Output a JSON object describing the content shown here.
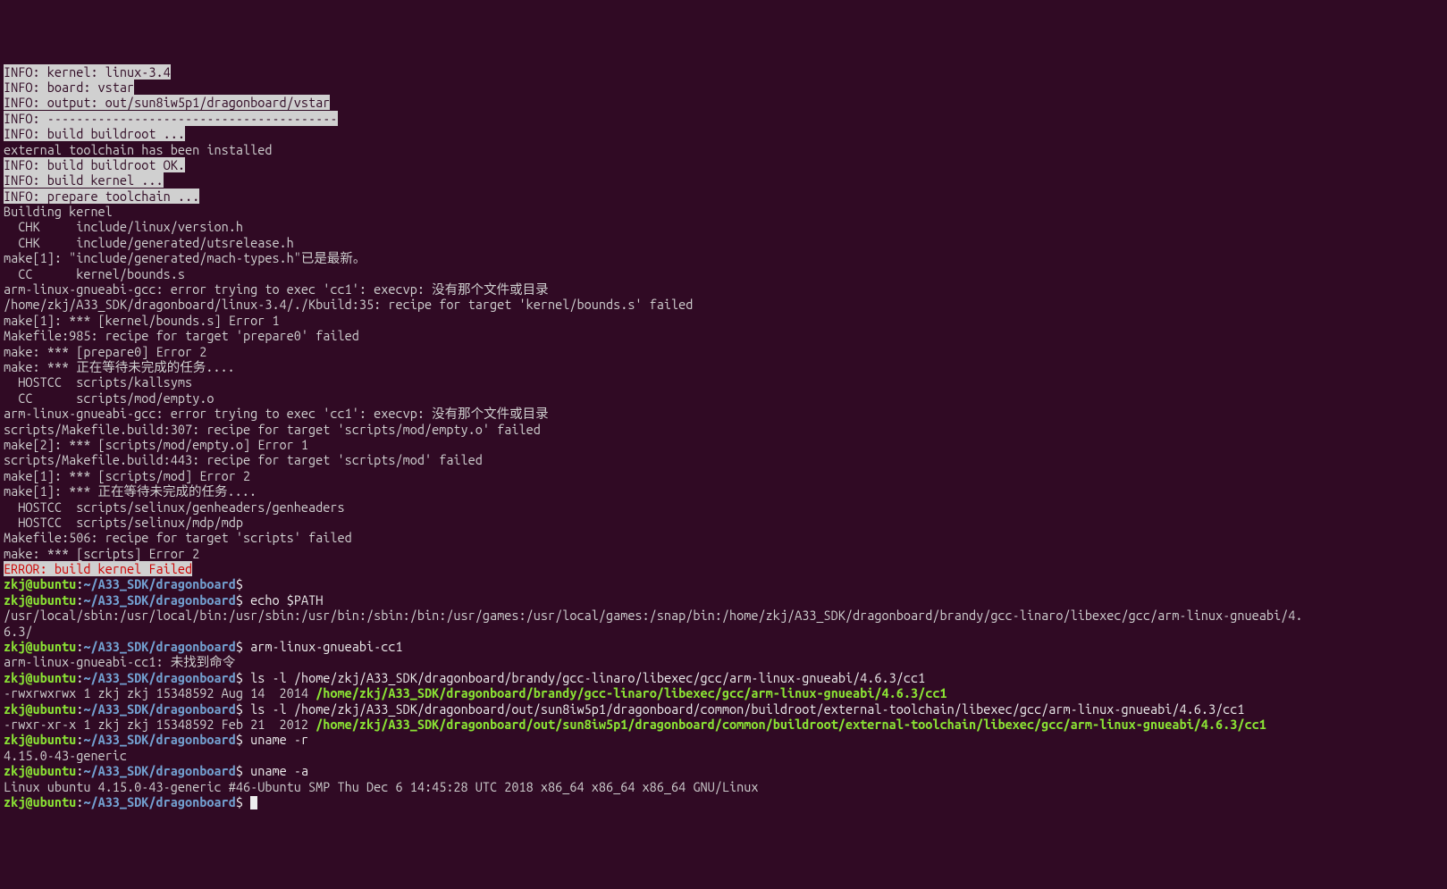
{
  "lines": [
    {
      "segs": [
        {
          "t": "INFO: kernel: linux-3.4",
          "cls": "hl"
        }
      ]
    },
    {
      "segs": [
        {
          "t": "INFO: board: vstar",
          "cls": "hl"
        }
      ]
    },
    {
      "segs": [
        {
          "t": "INFO: output: out/sun8iw5p1/dragonboard/vstar",
          "cls": "hl"
        }
      ]
    },
    {
      "segs": [
        {
          "t": "INFO: ----------------------------------------",
          "cls": "hl"
        }
      ]
    },
    {
      "segs": [
        {
          "t": "INFO: build buildroot ...",
          "cls": "hl"
        }
      ]
    },
    {
      "segs": [
        {
          "t": "external toolchain has been installed",
          "cls": ""
        }
      ]
    },
    {
      "segs": [
        {
          "t": "INFO: build buildroot OK.",
          "cls": "hl"
        }
      ]
    },
    {
      "segs": [
        {
          "t": "INFO: build kernel ...",
          "cls": "hl"
        }
      ]
    },
    {
      "segs": [
        {
          "t": "INFO: prepare toolchain ...",
          "cls": "hl"
        }
      ]
    },
    {
      "segs": [
        {
          "t": "Building kernel",
          "cls": ""
        }
      ]
    },
    {
      "segs": [
        {
          "t": "  CHK     include/linux/version.h",
          "cls": ""
        }
      ]
    },
    {
      "segs": [
        {
          "t": "  CHK     include/generated/utsrelease.h",
          "cls": ""
        }
      ]
    },
    {
      "segs": [
        {
          "t": "make[1]: \"include/generated/mach-types.h\"已是最新。",
          "cls": ""
        }
      ]
    },
    {
      "segs": [
        {
          "t": "  CC      kernel/bounds.s",
          "cls": ""
        }
      ]
    },
    {
      "segs": [
        {
          "t": "arm-linux-gnueabi-gcc: error trying to exec 'cc1': execvp: 没有那个文件或目录",
          "cls": ""
        }
      ]
    },
    {
      "segs": [
        {
          "t": "/home/zkj/A33_SDK/dragonboard/linux-3.4/./Kbuild:35: recipe for target 'kernel/bounds.s' failed",
          "cls": ""
        }
      ]
    },
    {
      "segs": [
        {
          "t": "make[1]: *** [kernel/bounds.s] Error 1",
          "cls": ""
        }
      ]
    },
    {
      "segs": [
        {
          "t": "Makefile:985: recipe for target 'prepare0' failed",
          "cls": ""
        }
      ]
    },
    {
      "segs": [
        {
          "t": "make: *** [prepare0] Error 2",
          "cls": ""
        }
      ]
    },
    {
      "segs": [
        {
          "t": "make: *** 正在等待未完成的任务....",
          "cls": ""
        }
      ]
    },
    {
      "segs": [
        {
          "t": "  HOSTCC  scripts/kallsyms",
          "cls": ""
        }
      ]
    },
    {
      "segs": [
        {
          "t": "  CC      scripts/mod/empty.o",
          "cls": ""
        }
      ]
    },
    {
      "segs": [
        {
          "t": "arm-linux-gnueabi-gcc: error trying to exec 'cc1': execvp: 没有那个文件或目录",
          "cls": ""
        }
      ]
    },
    {
      "segs": [
        {
          "t": "scripts/Makefile.build:307: recipe for target 'scripts/mod/empty.o' failed",
          "cls": ""
        }
      ]
    },
    {
      "segs": [
        {
          "t": "make[2]: *** [scripts/mod/empty.o] Error 1",
          "cls": ""
        }
      ]
    },
    {
      "segs": [
        {
          "t": "scripts/Makefile.build:443: recipe for target 'scripts/mod' failed",
          "cls": ""
        }
      ]
    },
    {
      "segs": [
        {
          "t": "make[1]: *** [scripts/mod] Error 2",
          "cls": ""
        }
      ]
    },
    {
      "segs": [
        {
          "t": "make[1]: *** 正在等待未完成的任务....",
          "cls": ""
        }
      ]
    },
    {
      "segs": [
        {
          "t": "  HOSTCC  scripts/selinux/genheaders/genheaders",
          "cls": ""
        }
      ]
    },
    {
      "segs": [
        {
          "t": "  HOSTCC  scripts/selinux/mdp/mdp",
          "cls": ""
        }
      ]
    },
    {
      "segs": [
        {
          "t": "Makefile:506: recipe for target 'scripts' failed",
          "cls": ""
        }
      ]
    },
    {
      "segs": [
        {
          "t": "make: *** [scripts] Error 2",
          "cls": ""
        }
      ]
    },
    {
      "segs": [
        {
          "t": "ERROR: build kernel Failed",
          "cls": "err-hl"
        }
      ]
    },
    {
      "prompt": true,
      "cmd": ""
    },
    {
      "prompt": true,
      "cmd": "echo $PATH"
    },
    {
      "segs": [
        {
          "t": "/usr/local/sbin:/usr/local/bin:/usr/sbin:/usr/bin:/sbin:/bin:/usr/games:/usr/local/games:/snap/bin:/home/zkj/A33_SDK/dragonboard/brandy/gcc-linaro/libexec/gcc/arm-linux-gnueabi/4.",
          "cls": ""
        }
      ]
    },
    {
      "segs": [
        {
          "t": "6.3/",
          "cls": ""
        }
      ]
    },
    {
      "prompt": true,
      "cmd": "arm-linux-gnueabi-cc1"
    },
    {
      "segs": [
        {
          "t": "arm-linux-gnueabi-cc1: 未找到命令",
          "cls": ""
        }
      ]
    },
    {
      "prompt": true,
      "cmd": "ls -l /home/zkj/A33_SDK/dragonboard/brandy/gcc-linaro/libexec/gcc/arm-linux-gnueabi/4.6.3/cc1"
    },
    {
      "segs": [
        {
          "t": "-rwxrwxrwx 1 zkj zkj 15348592 Aug 14  2014 ",
          "cls": ""
        },
        {
          "t": "/home/zkj/A33_SDK/dragonboard/brandy/gcc-linaro/libexec/gcc/arm-linux-gnueabi/4.6.3/cc1",
          "cls": "green"
        }
      ]
    },
    {
      "prompt": true,
      "cmd": "ls -l /home/zkj/A33_SDK/dragonboard/out/sun8iw5p1/dragonboard/common/buildroot/external-toolchain/libexec/gcc/arm-linux-gnueabi/4.6.3/cc1"
    },
    {
      "segs": [
        {
          "t": "-rwxr-xr-x 1 zkj zkj 15348592 Feb 21  2012 ",
          "cls": ""
        },
        {
          "t": "/home/zkj/A33_SDK/dragonboard/out/sun8iw5p1/dragonboard/common/buildroot/external-toolchain/libexec/gcc/arm-linux-gnueabi/4.6.3/cc1",
          "cls": "green"
        }
      ]
    },
    {
      "prompt": true,
      "cmd": "uname -r"
    },
    {
      "segs": [
        {
          "t": "4.15.0-43-generic",
          "cls": ""
        }
      ]
    },
    {
      "prompt": true,
      "cmd": "uname -a"
    },
    {
      "segs": [
        {
          "t": "Linux ubuntu 4.15.0-43-generic #46-Ubuntu SMP Thu Dec 6 14:45:28 UTC 2018 x86_64 x86_64 x86_64 GNU/Linux",
          "cls": ""
        }
      ]
    },
    {
      "prompt": true,
      "cmd": "",
      "cursor": true
    }
  ],
  "prompt": {
    "userhost": "zkj@ubuntu",
    "sep1": ":",
    "path": "~/A33_SDK/dragonboard",
    "sep2": "$ "
  }
}
